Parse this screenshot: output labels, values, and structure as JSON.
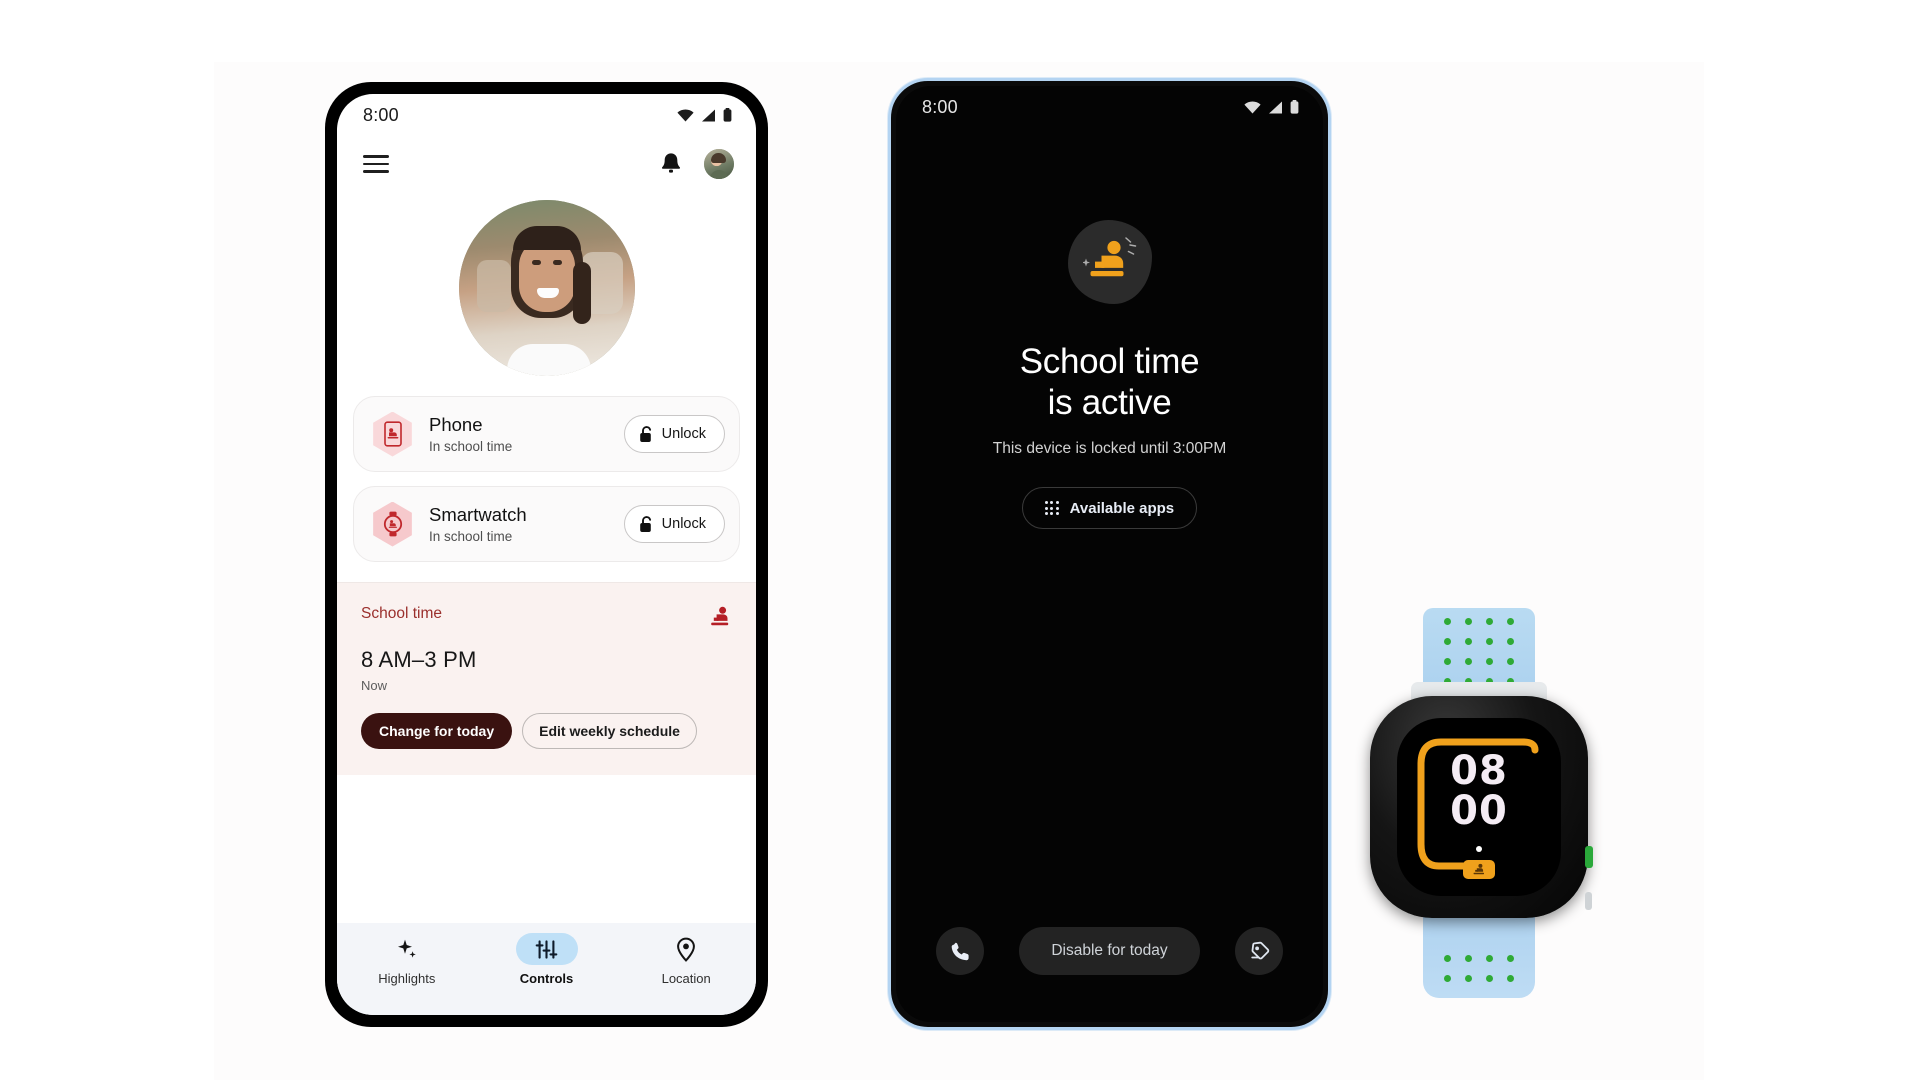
{
  "scene": {
    "background_color": "#ffffff",
    "panel_color": "#fdfcfc",
    "accent_red": "#9a2f2c",
    "accent_blue": "#bfe0f7",
    "accent_orange": "#f0a11c"
  },
  "phone1": {
    "status_bar": {
      "clock": "8:00",
      "icons": [
        "wifi-icon",
        "signal-icon",
        "battery-icon"
      ]
    },
    "header": {
      "menu_icon": "hamburger-menu-icon",
      "notification_icon": "bell-icon",
      "avatar": "parent-avatar"
    },
    "kid_photo_alt": "child-profile-photo",
    "devices": [
      {
        "icon": "phone-school-time-icon",
        "title": "Phone",
        "status": "In school time",
        "action_label": "Unlock",
        "action_icon": "unlock-icon"
      },
      {
        "icon": "watch-school-time-icon",
        "title": "Smartwatch",
        "status": "In school time",
        "action_label": "Unlock",
        "action_icon": "unlock-icon"
      }
    ],
    "school_time_card": {
      "label": "School time",
      "icon": "school-time-icon",
      "time_range": "8 AM–3 PM",
      "state": "Now",
      "primary_action": "Change for today",
      "secondary_action": "Edit weekly schedule"
    },
    "bottom_nav": [
      {
        "icon": "sparkle-icon",
        "label": "Highlights",
        "active": false
      },
      {
        "icon": "sliders-icon",
        "label": "Controls",
        "active": true
      },
      {
        "icon": "location-pin-icon",
        "label": "Location",
        "active": false
      }
    ]
  },
  "phone2": {
    "status_bar": {
      "clock": "8:00",
      "icons": [
        "wifi-icon",
        "signal-icon",
        "battery-icon"
      ]
    },
    "lock_screen": {
      "illustration": "school-time-person-icon",
      "title_line1": "School time",
      "title_line2": "is active",
      "subtitle": "This device is locked until 3:00PM",
      "apps_button_label": "Available apps",
      "apps_button_icon": "app-grid-icon"
    },
    "footer": {
      "call_icon": "phone-call-icon",
      "disable_label": "Disable for today",
      "right_icon": "emergency-tag-icon"
    }
  },
  "smartwatch": {
    "time_hours": "08",
    "time_minutes": "00",
    "badge_icon": "school-time-icon",
    "band_color": "#b0d5f1",
    "hole_color": "#2faa36",
    "arc_color": "#f0a11c"
  }
}
